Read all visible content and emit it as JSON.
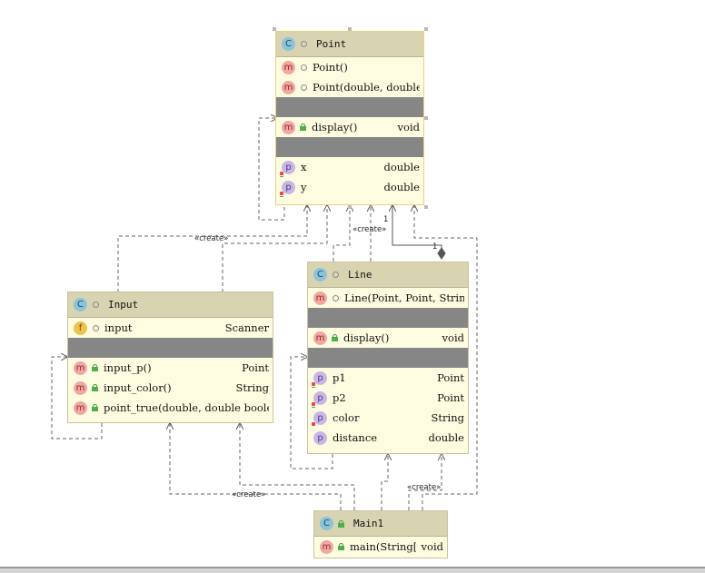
{
  "classes": {
    "point": {
      "title": "Point",
      "constructors": [
        {
          "name": "Point()",
          "type": ""
        },
        {
          "name": "Point(double, double)",
          "type": ""
        }
      ],
      "methods": [
        {
          "name": "display()",
          "type": "void"
        }
      ],
      "fields": [
        {
          "name": "x",
          "type": "double"
        },
        {
          "name": "y",
          "type": "double"
        }
      ]
    },
    "input": {
      "title": "Input",
      "fields": [
        {
          "name": "input",
          "type": "Scanner"
        }
      ],
      "methods": [
        {
          "name": "input_p()",
          "type": "Point"
        },
        {
          "name": "input_color()",
          "type": "String"
        },
        {
          "name": "point_true(double, double boolean",
          "type": ""
        }
      ]
    },
    "line": {
      "title": "Line",
      "constructors": [
        {
          "name": "Line(Point, Point, String)",
          "type": ""
        }
      ],
      "methods": [
        {
          "name": "display()",
          "type": "void"
        }
      ],
      "fields": [
        {
          "name": "p1",
          "type": "Point"
        },
        {
          "name": "p2",
          "type": "Point"
        },
        {
          "name": "color",
          "type": "String"
        },
        {
          "name": "distance",
          "type": "double"
        }
      ]
    },
    "main1": {
      "title": "Main1",
      "methods": [
        {
          "name": "main(String[])",
          "type": "void"
        }
      ]
    }
  },
  "icons": {
    "class": "C",
    "method": "m",
    "field": "f",
    "property": "p"
  },
  "labels": {
    "create_input_point": "«create»",
    "create_line_point": "«create»",
    "create_main_input": "«create»",
    "create_main_line": "«create»",
    "mult_point": "1",
    "mult_line": "1"
  },
  "colors": {
    "class_body": "#fefce0",
    "class_header": "#d8d4b2",
    "separator": "#868686",
    "edge": "#555555"
  }
}
